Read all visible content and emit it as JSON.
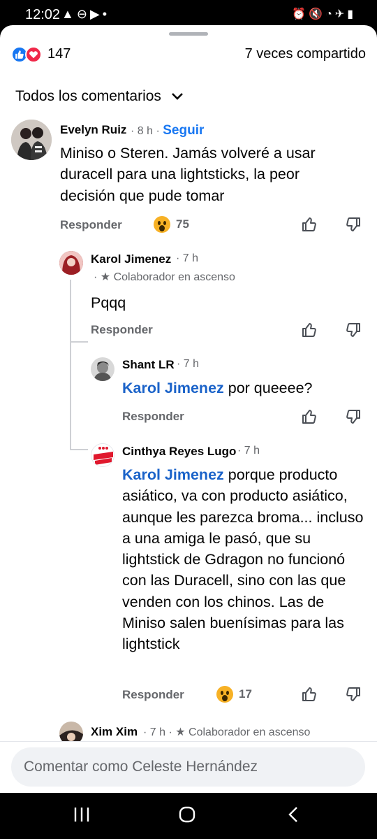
{
  "status_bar": {
    "time": "12:02",
    "left_icons": [
      "warning-icon",
      "minus-circle-icon",
      "youtube-icon",
      "dot-icon"
    ],
    "right_icons": [
      "alarm-icon",
      "mute-icon",
      "wifi-icon",
      "airplane-icon",
      "battery-icon"
    ]
  },
  "header": {
    "reaction_count": "147",
    "shares": "7 veces compartido"
  },
  "filter_label": "Todos los comentarios",
  "comments": [
    {
      "author": "Evelyn Ruiz",
      "time": "8 h",
      "follow": "Seguir",
      "text": "Miniso o Steren. Jamás volveré a usar duracell para una lightsticks, la peor decisión que pude tomar",
      "reply": "Responder",
      "reaction_count": "75"
    },
    {
      "author": "Karol Jimenez",
      "time": "7 h",
      "badge": "Colaborador en ascenso",
      "text": "Pqqq",
      "reply": "Responder"
    },
    {
      "author": "Shant LR",
      "time": "7 h",
      "mention": "Karol Jimenez",
      "text": " por queeee?",
      "reply": "Responder"
    },
    {
      "author": "Cinthya Reyes Lugo",
      "time": "7 h",
      "mention": "Karol Jimenez",
      "text": " porque producto asiático, va con producto asiático, aunque les parezca broma... incluso a una amiga le pasó,  que su lightstick de Gdragon no funcionó con las Duracell, sino con las que venden con los chinos. Las de Miniso salen buenísimas para las lightstick",
      "reply": "Responder",
      "reaction_count": "17"
    },
    {
      "author": "Xim Xim",
      "time": "7 h",
      "badge": "Colaborador en ascenso"
    }
  ],
  "composer": {
    "placeholder": "Comentar como Celeste Hernández"
  },
  "colors": {
    "accent": "#1877f2",
    "mention": "#1b63c9",
    "muted": "#65676b",
    "like": "#1877f2",
    "love": "#f02849"
  }
}
